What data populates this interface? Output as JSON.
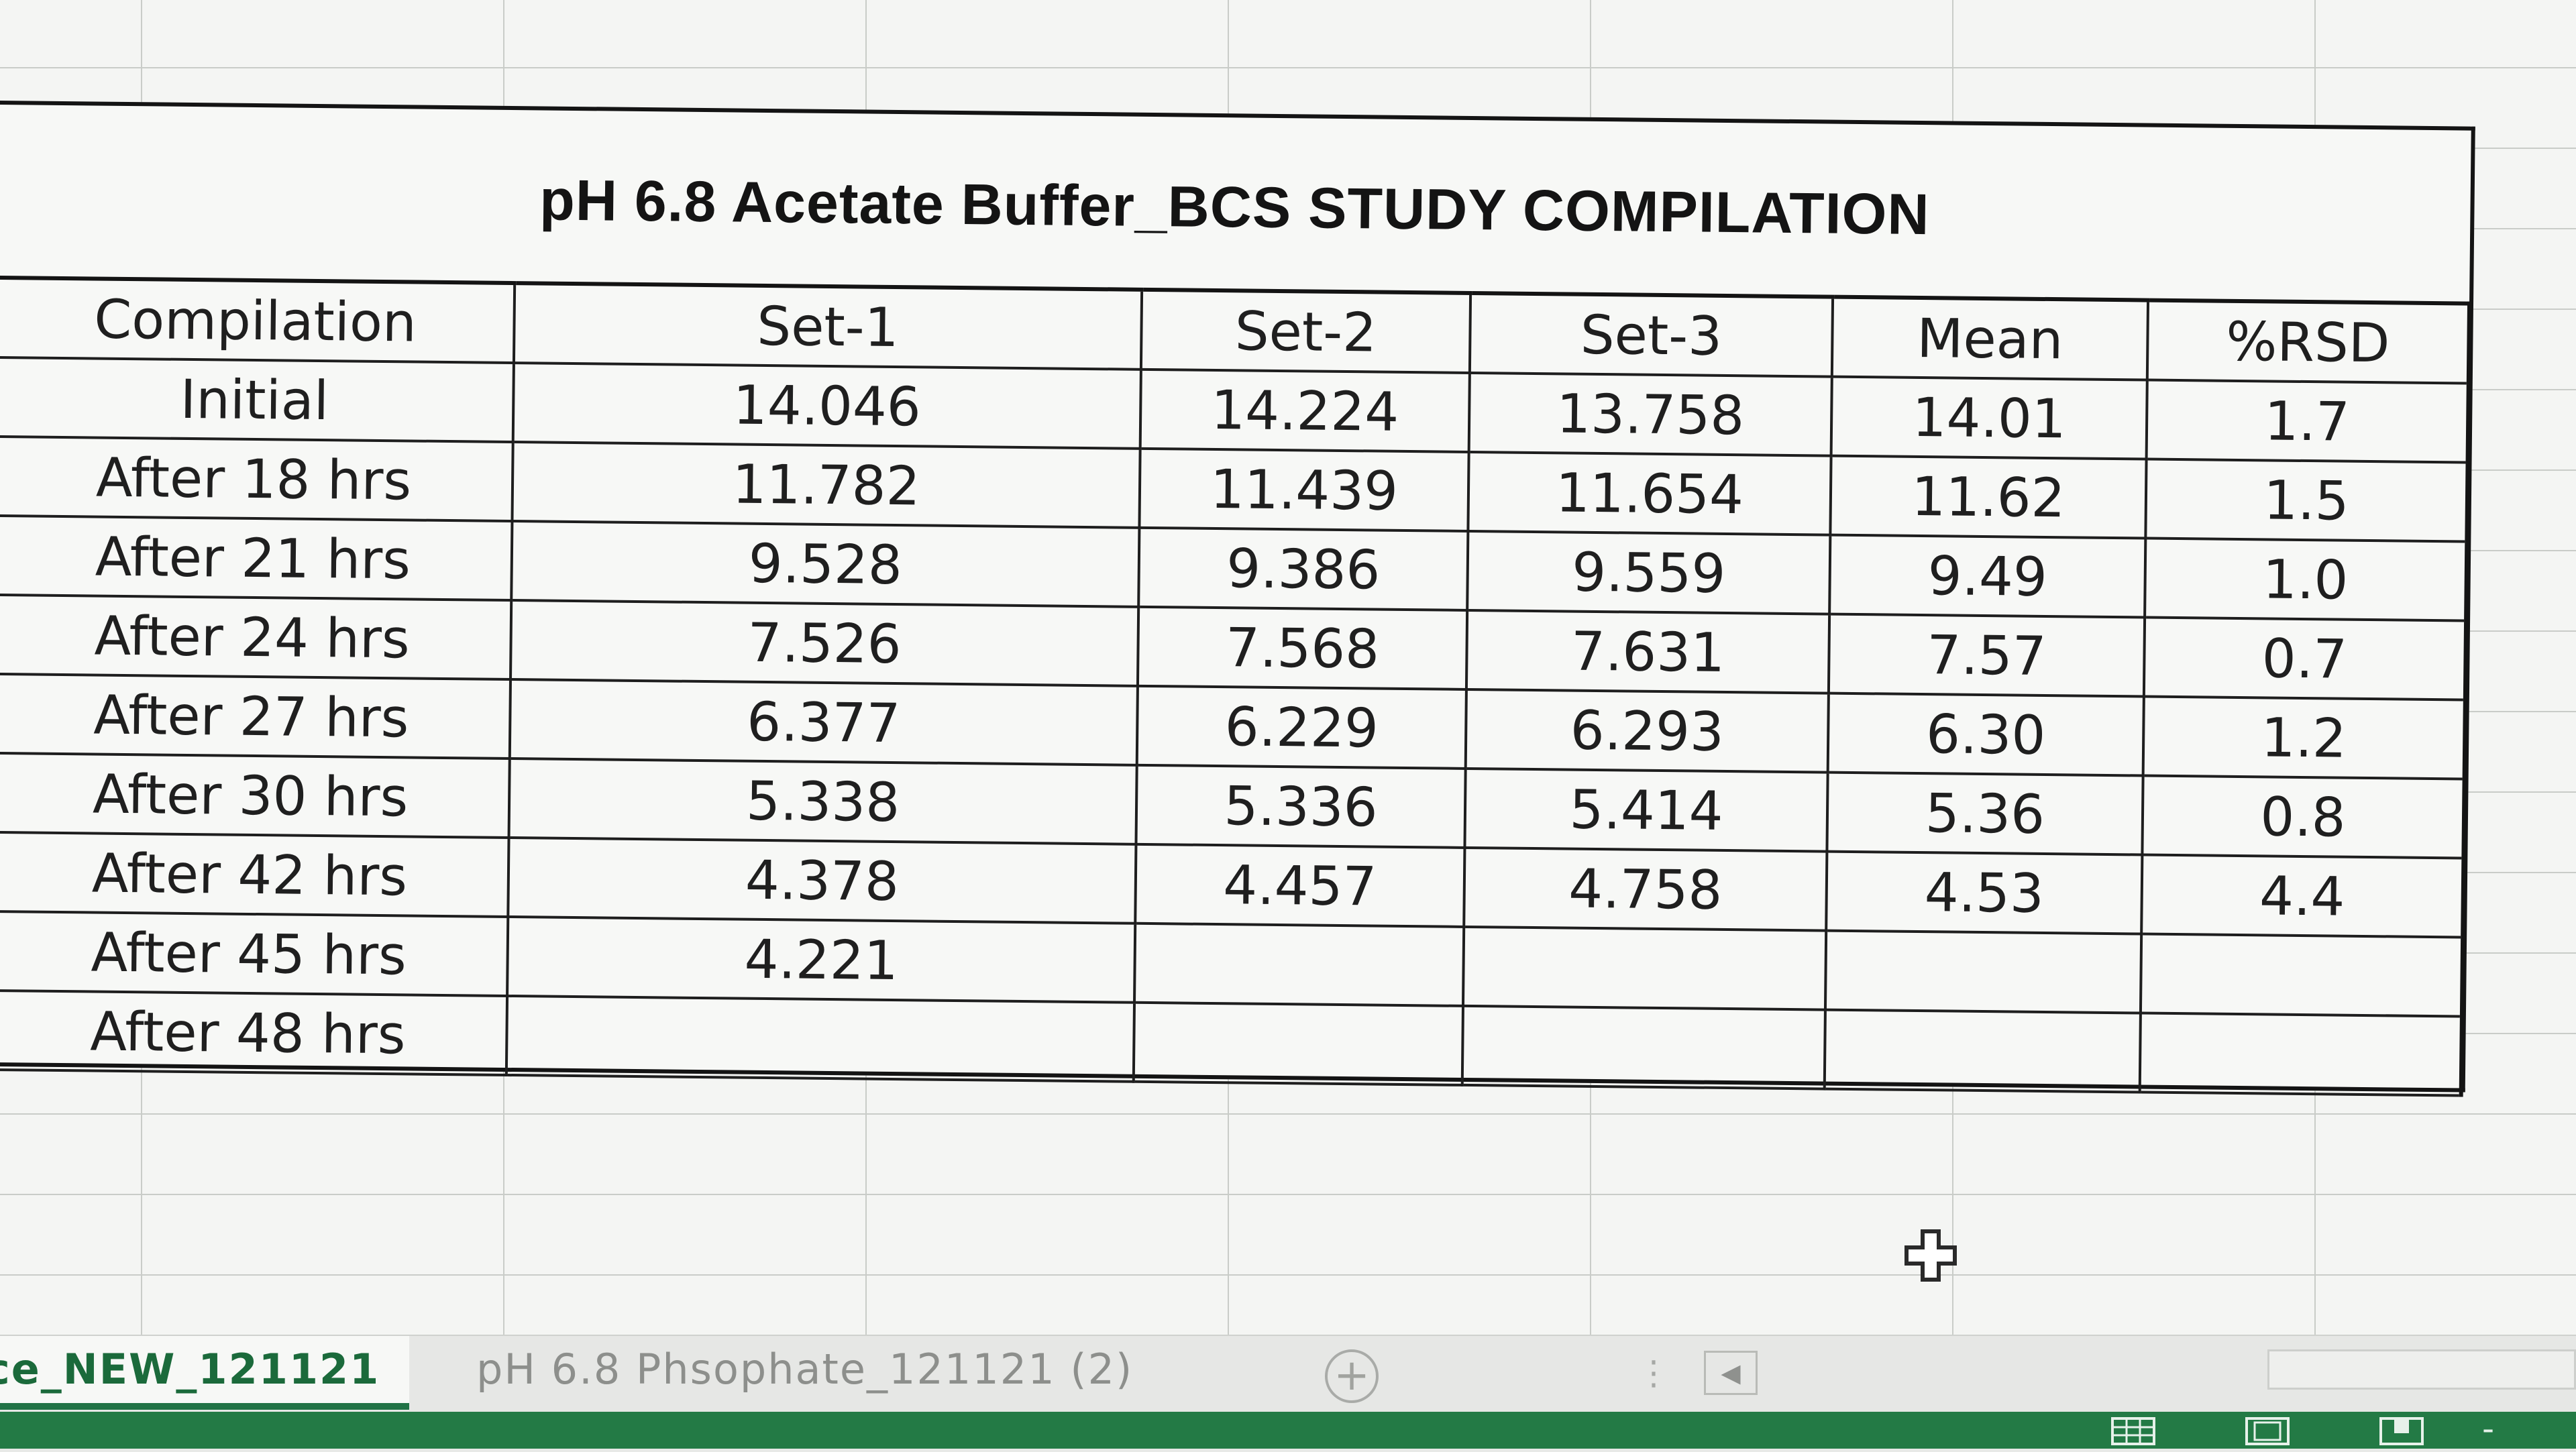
{
  "report": {
    "title": "pH 6.8 Acetate Buffer_BCS STUDY COMPILATION",
    "columns": [
      "Compilation",
      "Set-1",
      "Set-2",
      "Set-3",
      "Mean",
      "%RSD"
    ],
    "rows": [
      [
        "Initial",
        "14.046",
        "14.224",
        "13.758",
        "14.01",
        "1.7"
      ],
      [
        "After 18 hrs",
        "11.782",
        "11.439",
        "11.654",
        "11.62",
        "1.5"
      ],
      [
        "After 21 hrs",
        "9.528",
        "9.386",
        "9.559",
        "9.49",
        "1.0"
      ],
      [
        "After 24 hrs",
        "7.526",
        "7.568",
        "7.631",
        "7.57",
        "0.7"
      ],
      [
        "After 27 hrs",
        "6.377",
        "6.229",
        "6.293",
        "6.30",
        "1.2"
      ],
      [
        "After 30 hrs",
        "5.338",
        "5.336",
        "5.414",
        "5.36",
        "0.8"
      ],
      [
        "After 42 hrs",
        "4.378",
        "4.457",
        "4.758",
        "4.53",
        "4.4"
      ],
      [
        "After 45 hrs",
        "4.221",
        "",
        "",
        "",
        ""
      ],
      [
        "After 48 hrs",
        "",
        "",
        "",
        "",
        ""
      ]
    ]
  },
  "cursor": {
    "icon": "cell-select-cross-icon"
  },
  "tabs": {
    "active_label": "ce_NEW_121121",
    "inactive_label": "pH 6.8 Phsophate_121121 (2)",
    "add_icon": "plus-circle-icon",
    "dots_icon": "vertical-dots-icon",
    "scroll_left_icon": "triangle-left-icon"
  },
  "status_bar": {
    "color": "#237a45",
    "normal_view_icon": "grid-icon",
    "page_layout_icon": "page-layout-icon",
    "page_break_icon": "page-break-icon",
    "zoom_out_label": "-"
  },
  "colors": {
    "active_tab_text": "#1b6a3b",
    "active_tab_underline": "#217346"
  }
}
